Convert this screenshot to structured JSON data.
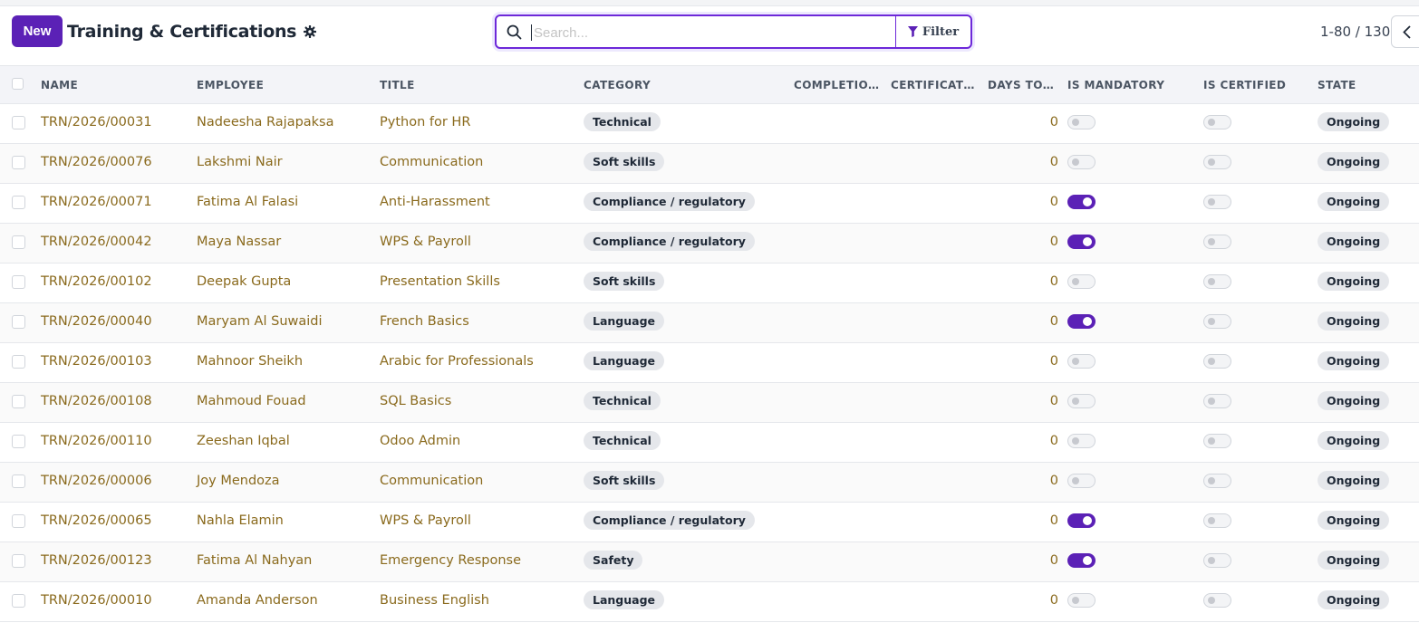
{
  "header": {
    "new_label": "New",
    "title": "Training & Certifications",
    "search_placeholder": "Search...",
    "filter_label": "Filter",
    "pager": "1-80 / 130"
  },
  "colors": {
    "accent": "#5b21b6",
    "link": "#8a6a1d",
    "badge_bg": "#e5e7eb"
  },
  "columns": {
    "name": "NAME",
    "employee": "EMPLOYEE",
    "title": "TITLE",
    "category": "CATEGORY",
    "completion": "COMPLETION...",
    "certificate": "CERTIFICATE ...",
    "days": "DAYS TO E...",
    "mandatory": "IS MANDATORY",
    "certified": "IS CERTIFIED",
    "state": "STATE"
  },
  "rows": [
    {
      "name": "TRN/2026/00031",
      "employee": "Nadeesha Rajapaksa",
      "title": "Python for HR",
      "category": "Technical",
      "days": "0",
      "mandatory": false,
      "certified": false,
      "state": "Ongoing"
    },
    {
      "name": "TRN/2026/00076",
      "employee": "Lakshmi Nair",
      "title": "Communication",
      "category": "Soft skills",
      "days": "0",
      "mandatory": false,
      "certified": false,
      "state": "Ongoing"
    },
    {
      "name": "TRN/2026/00071",
      "employee": "Fatima Al Falasi",
      "title": "Anti-Harassment",
      "category": "Compliance / regulatory",
      "days": "0",
      "mandatory": true,
      "certified": false,
      "state": "Ongoing"
    },
    {
      "name": "TRN/2026/00042",
      "employee": "Maya Nassar",
      "title": "WPS & Payroll",
      "category": "Compliance / regulatory",
      "days": "0",
      "mandatory": true,
      "certified": false,
      "state": "Ongoing"
    },
    {
      "name": "TRN/2026/00102",
      "employee": "Deepak Gupta",
      "title": "Presentation Skills",
      "category": "Soft skills",
      "days": "0",
      "mandatory": false,
      "certified": false,
      "state": "Ongoing"
    },
    {
      "name": "TRN/2026/00040",
      "employee": "Maryam Al Suwaidi",
      "title": "French Basics",
      "category": "Language",
      "days": "0",
      "mandatory": true,
      "certified": false,
      "state": "Ongoing"
    },
    {
      "name": "TRN/2026/00103",
      "employee": "Mahnoor Sheikh",
      "title": "Arabic for Professionals",
      "category": "Language",
      "days": "0",
      "mandatory": false,
      "certified": false,
      "state": "Ongoing"
    },
    {
      "name": "TRN/2026/00108",
      "employee": "Mahmoud Fouad",
      "title": "SQL Basics",
      "category": "Technical",
      "days": "0",
      "mandatory": false,
      "certified": false,
      "state": "Ongoing"
    },
    {
      "name": "TRN/2026/00110",
      "employee": "Zeeshan Iqbal",
      "title": "Odoo Admin",
      "category": "Technical",
      "days": "0",
      "mandatory": false,
      "certified": false,
      "state": "Ongoing"
    },
    {
      "name": "TRN/2026/00006",
      "employee": "Joy Mendoza",
      "title": "Communication",
      "category": "Soft skills",
      "days": "0",
      "mandatory": false,
      "certified": false,
      "state": "Ongoing"
    },
    {
      "name": "TRN/2026/00065",
      "employee": "Nahla Elamin",
      "title": "WPS & Payroll",
      "category": "Compliance / regulatory",
      "days": "0",
      "mandatory": true,
      "certified": false,
      "state": "Ongoing"
    },
    {
      "name": "TRN/2026/00123",
      "employee": "Fatima Al Nahyan",
      "title": "Emergency Response",
      "category": "Safety",
      "days": "0",
      "mandatory": true,
      "certified": false,
      "state": "Ongoing"
    },
    {
      "name": "TRN/2026/00010",
      "employee": "Amanda Anderson",
      "title": "Business English",
      "category": "Language",
      "days": "0",
      "mandatory": false,
      "certified": false,
      "state": "Ongoing"
    }
  ]
}
